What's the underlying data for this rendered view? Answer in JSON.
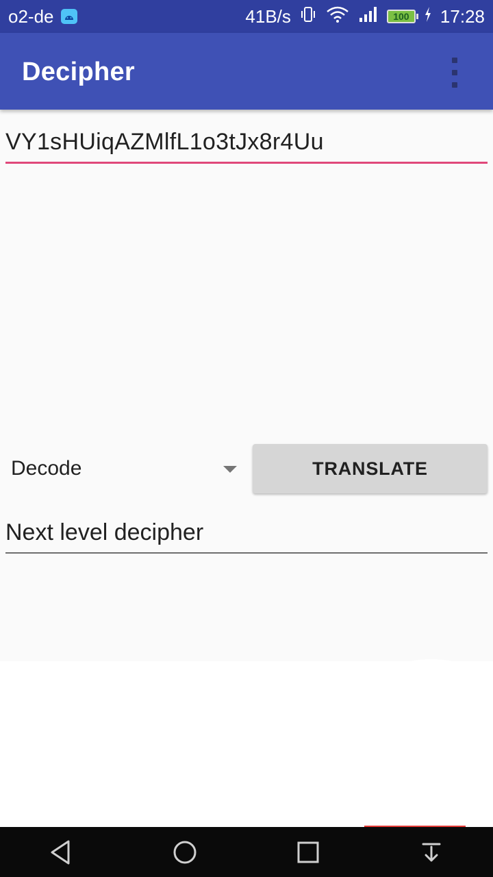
{
  "status_bar": {
    "carrier": "o2-de",
    "speed": "41B/s",
    "battery": "100",
    "time": "17:28"
  },
  "app_bar": {
    "title": "Decipher"
  },
  "input": {
    "value": "VY1sHUiqAZMlfL1o3tJx8r4Uu"
  },
  "mode_spinner": {
    "selected": "Decode"
  },
  "translate_button": {
    "label": "TRANSLATE"
  },
  "output": {
    "value": "Next level decipher"
  },
  "colors": {
    "status_bar": "#303f9f",
    "app_bar": "#3f51b5",
    "accent": "#e0487a",
    "button": "#d6d6d6"
  },
  "nav": {
    "icons": [
      "back-icon",
      "home-icon",
      "recents-icon",
      "notification-pull-icon"
    ]
  }
}
